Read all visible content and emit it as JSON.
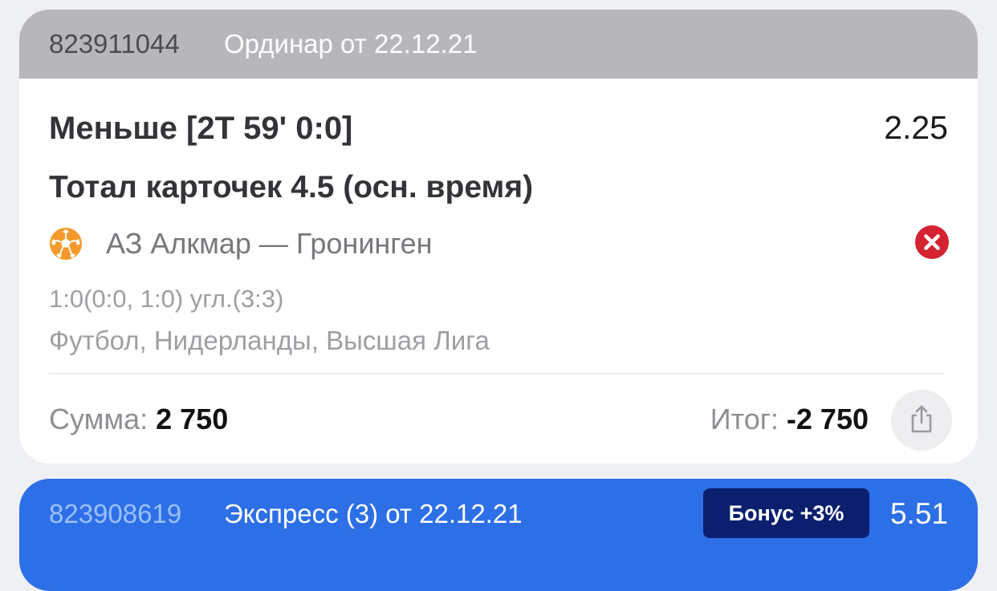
{
  "bet1": {
    "id": "823911044",
    "type": "Ординар от 22.12.21",
    "outcome": "Меньше [2T 59' 0:0]",
    "odds": "2.25",
    "market": "Тотал карточек 4.5 (осн. время)",
    "sport_icon": "football-icon",
    "match": "АЗ Алкмар — Гронинген",
    "status_icon": "lost-icon",
    "status_color": "#d42230",
    "score": "1:0(0:0, 1:0) угл.(3:3)",
    "league": "Футбол, Нидерланды, Высшая Лига",
    "sum_label": "Сумма: ",
    "sum_value": "2 750",
    "result_label": "Итог: ",
    "result_value": "-2 750",
    "share_icon": "share-icon"
  },
  "bet2": {
    "id": "823908619",
    "type": "Экспресс (3) от 22.12.21",
    "bonus": "Бонус +3%",
    "odds": "5.51",
    "accent_color": "#2d6fe7"
  }
}
